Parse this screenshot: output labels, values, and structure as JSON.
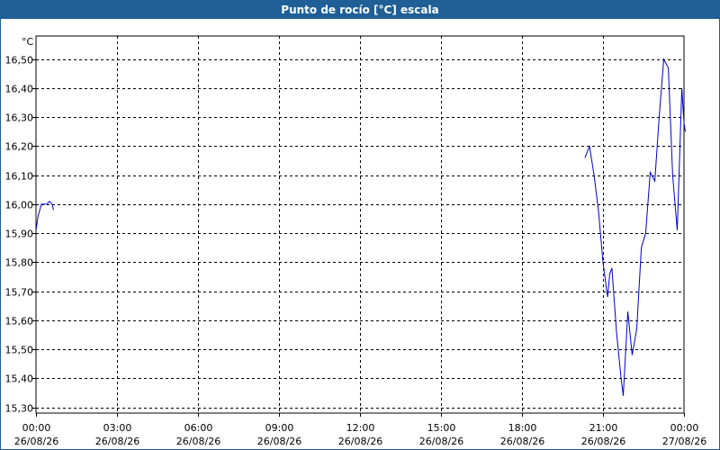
{
  "window": {
    "title": "Punto de rocío [°C] escala"
  },
  "chart_data": {
    "type": "line",
    "title": "Punto de rocío [°C] escala",
    "ylabel": "°C",
    "xlabel": "",
    "ylim": [
      15.28,
      16.58
    ],
    "yticks": [
      15.3,
      15.4,
      15.5,
      15.6,
      15.7,
      15.8,
      15.9,
      16.0,
      16.1,
      16.2,
      16.3,
      16.4,
      16.5
    ],
    "ytick_labels": [
      "15,30",
      "15,40",
      "15,50",
      "15,60",
      "15,70",
      "15,80",
      "15,90",
      "16,00",
      "16,10",
      "16,20",
      "16,30",
      "16,40",
      "16,50"
    ],
    "xlim": [
      0,
      24
    ],
    "xticks": [
      0,
      3,
      6,
      9,
      12,
      15,
      18,
      21,
      24
    ],
    "xtick_labels": [
      {
        "time": "00:00",
        "date": "26/08/26"
      },
      {
        "time": "03:00",
        "date": "26/08/26"
      },
      {
        "time": "06:00",
        "date": "26/08/26"
      },
      {
        "time": "09:00",
        "date": "26/08/26"
      },
      {
        "time": "12:00",
        "date": "26/08/26"
      },
      {
        "time": "15:00",
        "date": "26/08/26"
      },
      {
        "time": "18:00",
        "date": "26/08/26"
      },
      {
        "time": "21:00",
        "date": "26/08/26"
      },
      {
        "time": "00:00",
        "date": "27/08/26"
      }
    ],
    "grid": true,
    "line_color": "#0000cc",
    "series": [
      {
        "segments": [
          [
            [
              0.0,
              15.91
            ],
            [
              0.08,
              15.96
            ],
            [
              0.2,
              16.0
            ],
            [
              0.4,
              16.0
            ],
            [
              0.5,
              16.01
            ],
            [
              0.6,
              16.0
            ],
            [
              0.65,
              15.98
            ]
          ],
          [
            [
              20.33,
              16.16
            ],
            [
              20.5,
              16.2
            ],
            [
              20.67,
              16.1
            ],
            [
              20.83,
              15.98
            ],
            [
              21.0,
              15.8
            ],
            [
              21.17,
              15.68
            ],
            [
              21.25,
              15.76
            ],
            [
              21.33,
              15.78
            ],
            [
              21.5,
              15.56
            ],
            [
              21.67,
              15.4
            ],
            [
              21.75,
              15.34
            ],
            [
              21.92,
              15.63
            ],
            [
              22.08,
              15.48
            ],
            [
              22.25,
              15.57
            ],
            [
              22.42,
              15.85
            ],
            [
              22.58,
              15.9
            ],
            [
              22.75,
              16.11
            ],
            [
              22.92,
              16.08
            ],
            [
              23.08,
              16.3
            ],
            [
              23.25,
              16.5
            ],
            [
              23.42,
              16.47
            ],
            [
              23.58,
              16.1
            ],
            [
              23.75,
              15.91
            ],
            [
              23.92,
              16.4
            ],
            [
              24.0,
              16.28
            ],
            [
              24.05,
              16.25
            ]
          ]
        ]
      }
    ]
  }
}
